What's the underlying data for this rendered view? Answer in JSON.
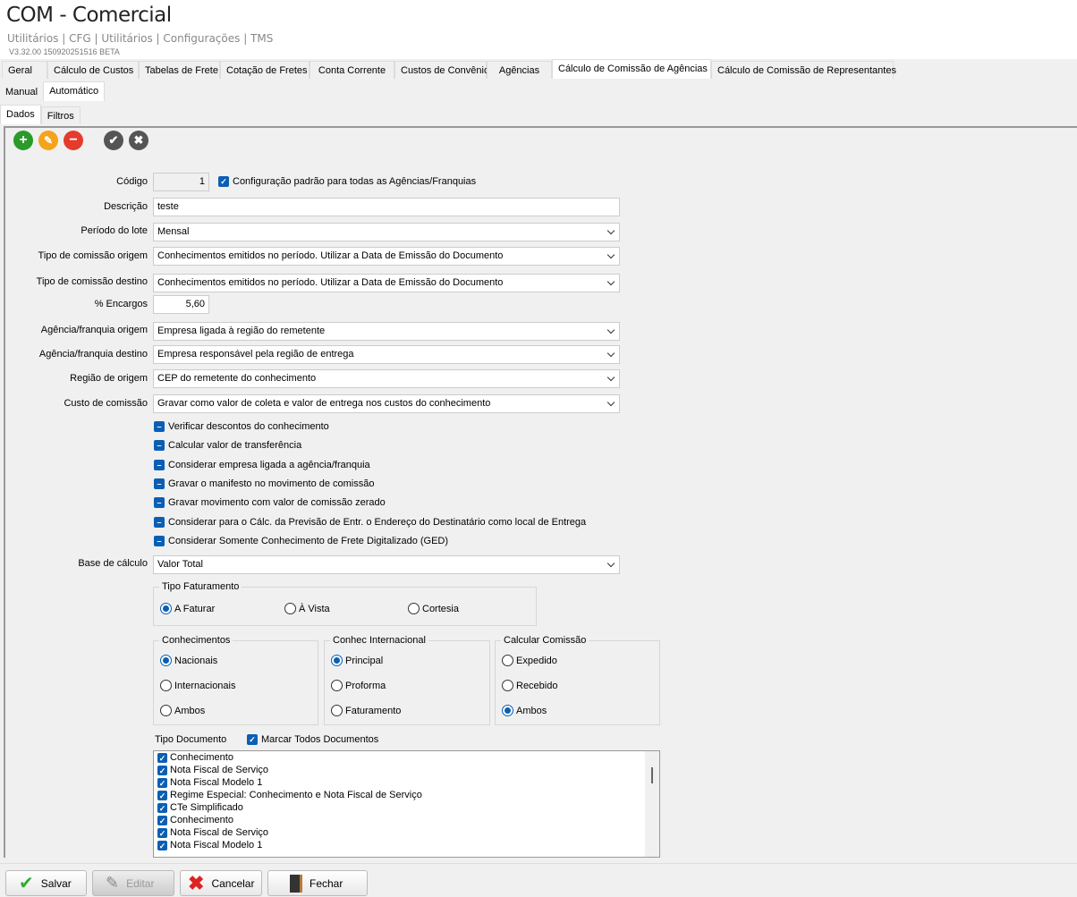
{
  "header": {
    "title": "COM - Comercial",
    "breadcrumb": "Utilitários | CFG | Utilitários | Configurações | TMS",
    "version": "V3.32.00 150920251516 BETA"
  },
  "main_tabs": [
    "Geral",
    "Cálculo de Custos",
    "Tabelas de Frete",
    "Cotação de Fretes",
    "Conta Corrente",
    "Custos de Convênio",
    "Agências",
    "Cálculo de Comissão de Agências",
    "Cálculo de Comissão de Representantes"
  ],
  "sub_tabs": [
    "Manual",
    "Automático"
  ],
  "inner_tabs": [
    "Dados",
    "Filtros"
  ],
  "toolbar": [
    "add-icon",
    "edit-icon",
    "remove-icon",
    "confirm-icon",
    "cancel-icon"
  ],
  "form": {
    "codigo_label": "Código",
    "codigo": "1",
    "default_config": "Configuração padrão para todas as Agências/Franquias",
    "descricao_label": "Descrição",
    "descricao": "teste",
    "periodo_label": "Período do lote",
    "periodo": "Mensal",
    "tipo_origem_label": "Tipo de comissão origem",
    "tipo_origem": "Conhecimentos emitidos no período. Utilizar a Data de Emissão do Documento",
    "tipo_destino_label": "Tipo de comissão destino",
    "tipo_destino": "Conhecimentos emitidos no período. Utilizar a Data de Emissão do Documento",
    "encargos_label": "% Encargos",
    "encargos": "5,60",
    "ag_origem_label": "Agência/franquia origem",
    "ag_origem": "Empresa ligada à região do remetente",
    "ag_destino_label": "Agência/franquia destino",
    "ag_destino": "Empresa responsável pela região de entrega",
    "regiao_label": "Região de origem",
    "regiao": "CEP do remetente do conhecimento",
    "custo_label": "Custo de comissão",
    "custo": "Gravar como valor de coleta e valor de entrega nos custos do conhecimento",
    "options": [
      "Verificar descontos do conhecimento",
      "Calcular valor de transferência",
      "Considerar empresa ligada a agência/franquia",
      "Gravar o manifesto no movimento de comissão",
      "Gravar movimento com valor de comissão zerado",
      "Considerar para o Cálc. da Previsão de Entr. o Endereço do Destinatário como local de Entrega",
      "Considerar Somente Conhecimento de Frete Digitalizado (GED)"
    ],
    "base_label": "Base de cálculo",
    "base": "Valor Total"
  },
  "tipo_faturamento": {
    "title": "Tipo Faturamento",
    "options": [
      "A Faturar",
      "À Vista",
      "Cortesia"
    ],
    "selected": 0
  },
  "conhecimentos": {
    "title": "Conhecimentos",
    "options": [
      "Nacionais",
      "Internacionais",
      "Ambos"
    ],
    "selected": 0
  },
  "conhec_internacional": {
    "title": "Conhec Internacional",
    "options": [
      "Principal",
      "Proforma",
      "Faturamento"
    ],
    "selected": 0
  },
  "calcular_comissao": {
    "title": "Calcular Comissão",
    "options": [
      "Expedido",
      "Recebido",
      "Ambos"
    ],
    "selected": 2
  },
  "tipo_documento": {
    "label": "Tipo Documento",
    "mark_all": "Marcar Todos Documentos",
    "items": [
      "Conhecimento",
      "Nota Fiscal de Serviço",
      "Nota Fiscal Modelo 1",
      "Regime Especial: Conhecimento e Nota Fiscal de Serviço",
      "CTe Simplificado",
      "Conhecimento",
      "Nota Fiscal de Serviço",
      "Nota Fiscal Modelo 1"
    ]
  },
  "buttons": {
    "salvar": "Salvar",
    "editar": "Editar",
    "cancelar": "Cancelar",
    "fechar": "Fechar"
  }
}
